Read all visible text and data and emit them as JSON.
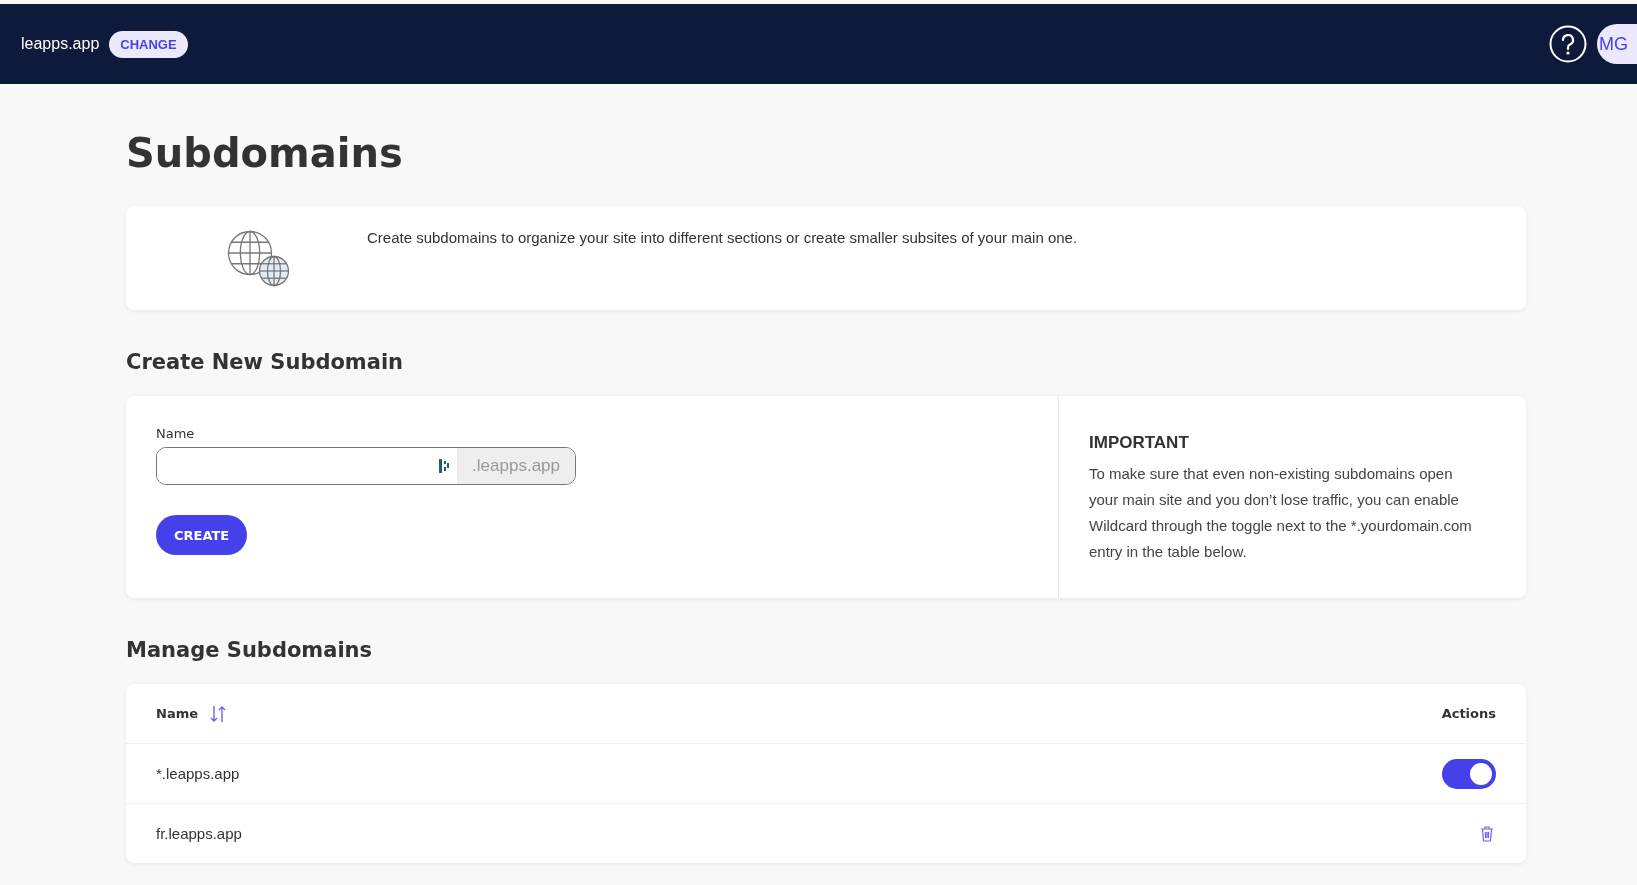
{
  "header": {
    "site": "leapps.app",
    "change_button": "CHANGE",
    "avatar": "MG"
  },
  "title": "Subdomains",
  "intro": "Create subdomains to organize your site into different sections or create smaller subsites of your main one.",
  "create": {
    "heading": "Create New Subdomain",
    "field_label": "Name",
    "suffix": ".leapps.app",
    "button": "CREATE",
    "note_title": "IMPORTANT",
    "note": "To make sure that even non-existing subdomains open your main site and you don’t lose traffic, you can enable Wildcard through the toggle next to the *.yourdomain.com entry in the table below."
  },
  "manage": {
    "heading": "Manage Subdomains",
    "columns": [
      "Name",
      "Actions"
    ],
    "rows": [
      {
        "name": "*.leapps.app",
        "kind": "toggle",
        "on": true
      },
      {
        "name": "fr.leapps.app",
        "kind": "delete"
      }
    ]
  }
}
